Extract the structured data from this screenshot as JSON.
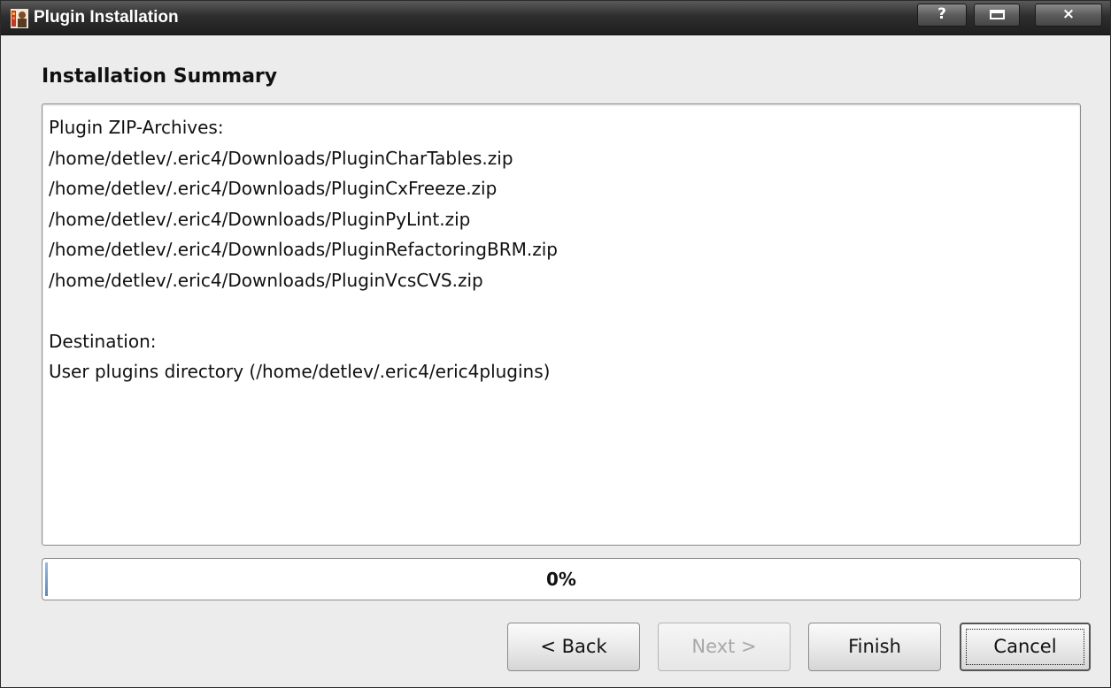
{
  "window": {
    "title": "Plugin Installation",
    "icon": "plugin-app-icon",
    "help_glyph": "?",
    "close_glyph": "×"
  },
  "page": {
    "heading": "Installation Summary"
  },
  "summary": {
    "lines": [
      "Plugin ZIP-Archives:",
      "/home/detlev/.eric4/Downloads/PluginCharTables.zip",
      "/home/detlev/.eric4/Downloads/PluginCxFreeze.zip",
      "/home/detlev/.eric4/Downloads/PluginPyLint.zip",
      "/home/detlev/.eric4/Downloads/PluginRefactoringBRM.zip",
      "/home/detlev/.eric4/Downloads/PluginVcsCVS.zip",
      "",
      "Destination:",
      "User plugins directory (/home/detlev/.eric4/eric4plugins)"
    ]
  },
  "progress": {
    "value": 0,
    "label": "0%"
  },
  "buttons": {
    "back": "< Back",
    "next": "Next >",
    "finish": "Finish",
    "cancel": "Cancel"
  },
  "colors": {
    "titlebar": "#2e2e2e",
    "progress_fill": "#5f86b3",
    "disabled_text": "#a8a8a8"
  }
}
